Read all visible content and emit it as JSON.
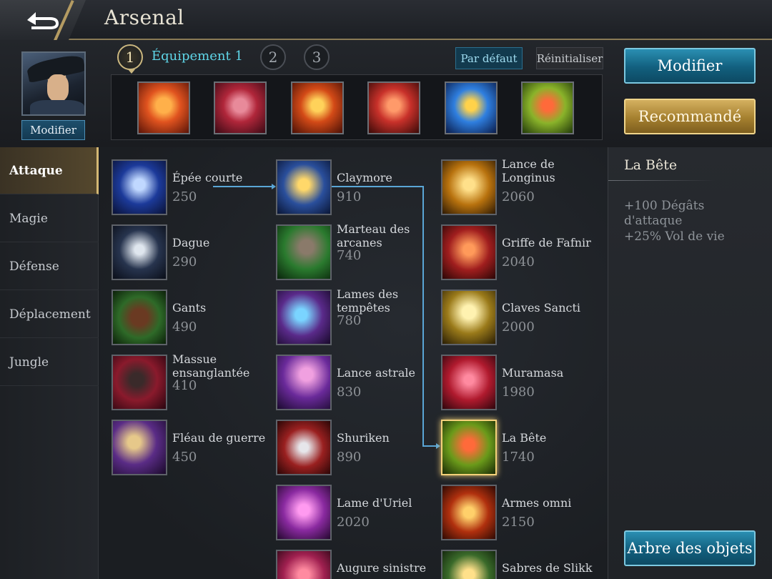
{
  "header": {
    "title": "Arsenal",
    "back_icon": "back-arrow-icon"
  },
  "hero": {
    "modify_label": "Modifier"
  },
  "slots": [
    {
      "number": "1",
      "active": true
    },
    {
      "number": "2",
      "active": false
    },
    {
      "number": "3",
      "active": false
    }
  ],
  "active_slot_label": "Équipement 1",
  "buttons": {
    "default": "Par défaut",
    "reset": "Réinitialiser",
    "modify": "Modifier",
    "recommended": "Recommandé",
    "item_tree": "Arbre des objets"
  },
  "equipped": [
    {
      "name": "claw-gauntlet-icon",
      "color": "#e0531f"
    },
    {
      "name": "boots-icon",
      "color": "#b0263a"
    },
    {
      "name": "dual-blade-icon",
      "color": "#d34a17"
    },
    {
      "name": "crimson-sword-icon",
      "color": "#c8312a"
    },
    {
      "name": "lightning-sword-icon",
      "color": "#2f7fe0"
    },
    {
      "name": "beast-sword-icon",
      "color": "#8ab32a"
    }
  ],
  "categories": [
    {
      "label": "Attaque",
      "active": true
    },
    {
      "label": "Magie",
      "active": false
    },
    {
      "label": "Défense",
      "active": false
    },
    {
      "label": "Déplacement",
      "active": false
    },
    {
      "label": "Jungle",
      "active": false
    }
  ],
  "items": {
    "col1": [
      {
        "name": "Épée courte",
        "price": "250",
        "icon": "short-sword-icon",
        "bg": "#1c3a9a"
      },
      {
        "name": "Dague",
        "price": "290",
        "icon": "dagger-icon",
        "bg": "#27344e"
      },
      {
        "name": "Gants",
        "price": "490",
        "icon": "gloves-icon",
        "bg": "#2e6a28"
      },
      {
        "name": "Massue ensanglantée",
        "price": "410",
        "icon": "bloody-mace-icon",
        "bg": "#8a1a2c"
      },
      {
        "name": "Fléau de guerre",
        "price": "450",
        "icon": "war-flail-icon",
        "bg": "#5a2c86"
      }
    ],
    "col2": [
      {
        "name": "Claymore",
        "price": "910",
        "icon": "claymore-icon",
        "bg": "#2a4f9c"
      },
      {
        "name": "Marteau des arcanes",
        "price": "740",
        "icon": "arcane-hammer-icon",
        "bg": "#2a7a2e"
      },
      {
        "name": "Lames des tempêtes",
        "price": "780",
        "icon": "storm-blades-icon",
        "bg": "#5a2a8a"
      },
      {
        "name": "Lance astrale",
        "price": "830",
        "icon": "astral-spear-icon",
        "bg": "#6a2a9a"
      },
      {
        "name": "Shuriken",
        "price": "890",
        "icon": "shuriken-icon",
        "bg": "#9a2020"
      },
      {
        "name": "Lame d'Uriel",
        "price": "2020",
        "icon": "uriel-blade-icon",
        "bg": "#8a2aa0"
      },
      {
        "name": "Augure sinistre",
        "price": "",
        "icon": "sinister-omen-icon",
        "bg": "#a02050"
      }
    ],
    "col3": [
      {
        "name": "Lance de Longinus",
        "price": "2060",
        "icon": "longinus-spear-icon",
        "bg": "#b8720e"
      },
      {
        "name": "Griffe de Fafnir",
        "price": "2040",
        "icon": "fafnir-claw-icon",
        "bg": "#a01e1e"
      },
      {
        "name": "Claves Sancti",
        "price": "2000",
        "icon": "claves-sancti-icon",
        "bg": "#9a7a1a"
      },
      {
        "name": "Muramasa",
        "price": "1980",
        "icon": "muramasa-icon",
        "bg": "#b01a2e"
      },
      {
        "name": "La Bête",
        "price": "1740",
        "icon": "beast-sword-icon",
        "bg": "#6a9a1a",
        "selected": true
      },
      {
        "name": "Armes omni",
        "price": "2150",
        "icon": "omni-arms-icon",
        "bg": "#b0300e"
      },
      {
        "name": "Sabres de Slikk",
        "price": "",
        "icon": "slikk-sabers-icon",
        "bg": "#3a6a2a"
      }
    ]
  },
  "detail": {
    "title": "La Bête",
    "stats": [
      "+100 Dégâts d'attaque",
      "+25% Vol de vie"
    ]
  },
  "accent_colors": {
    "cyan": "#5fd6e8",
    "gold": "#d3b774",
    "blue_button": "#125f7e"
  }
}
